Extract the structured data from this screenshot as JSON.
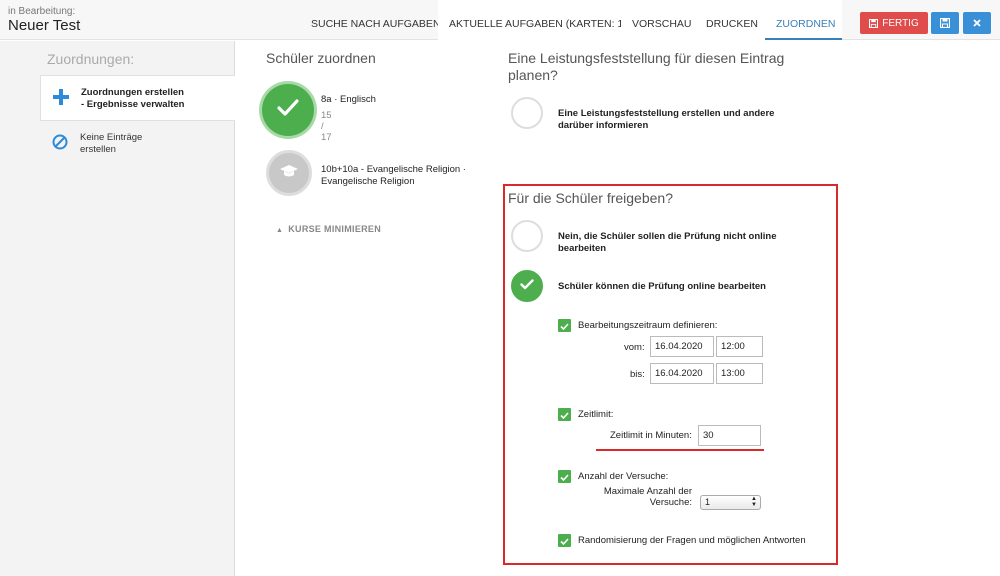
{
  "header": {
    "status_label": "in Bearbeitung:",
    "title": "Neuer Test",
    "nav": [
      {
        "label": "SUCHE NACH AUFGABEN"
      },
      {
        "label": "AKTUELLE AUFGABEN (KARTEN: 1)"
      },
      {
        "label": "VORSCHAU"
      },
      {
        "label": "DRUCKEN"
      },
      {
        "label": "ZUORDNEN"
      }
    ],
    "finish_label": "FERTIG"
  },
  "sidebar": {
    "title": "Zuordnungen:",
    "items": [
      {
        "line1": "Zuordnungen erstellen",
        "line2": "- Ergebnisse verwalten"
      },
      {
        "line1": "Keine Einträge",
        "line2": "erstellen"
      }
    ]
  },
  "students": {
    "title": "Schüler zuordnen",
    "courses": [
      {
        "name": "8a · Englisch",
        "count": "15 / 17"
      },
      {
        "name_line1": "10b+10a - Evangelische Religion ·",
        "name_line2": "Evangelische Religion"
      }
    ],
    "minimize_label": "KURSE MINIMIEREN"
  },
  "assessment": {
    "title": "Eine Leistungsfeststellung für diesen Eintrag planen?",
    "option_line1": "Eine Leistungsfeststellung erstellen und andere",
    "option_line2": "darüber informieren"
  },
  "release": {
    "title": "Für die Schüler freigeben?",
    "option_no_line1": "Nein, die Schüler sollen die Prüfung nicht online",
    "option_no_line2": "bearbeiten",
    "option_yes": "Schüler können die Prüfung online bearbeiten",
    "period_label": "Bearbeitungszeitraum definieren:",
    "from_label": "vom:",
    "from_date": "16.04.2020",
    "from_time": "12:00",
    "to_label": "bis:",
    "to_date": "16.04.2020",
    "to_time": "13:00",
    "timelimit_label": "Zeitlimit:",
    "timelimit_minutes_label": "Zeitlimit in Minuten:",
    "timelimit_value": "30",
    "attempts_label": "Anzahl der Versuche:",
    "max_attempts_line1": "Maximale Anzahl der",
    "max_attempts_line2": "Versuche:",
    "max_attempts_value": "1",
    "randomize_label": "Randomisierung der Fragen und möglichen Antworten"
  },
  "colors": {
    "accent_blue": "#3a90d6",
    "danger_red": "#e04b4b",
    "success_green": "#4cae4c",
    "highlight_red": "#d82a2a"
  }
}
